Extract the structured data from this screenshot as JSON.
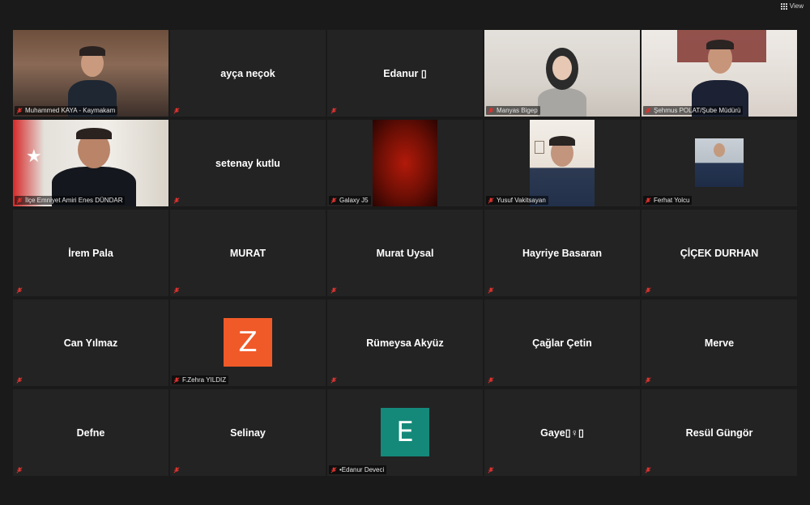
{
  "toolbar": {
    "view_label": "View"
  },
  "colors": {
    "background": "#1a1a1a",
    "tile": "#232323",
    "active_speaker_border": "#d6e86b",
    "muted_icon": "#e0332f"
  },
  "tiles": [
    {
      "type": "video",
      "label": "Muhammed KAYA - Kaymakam",
      "muted": true
    },
    {
      "type": "name",
      "name": "ayça neçok",
      "muted": true
    },
    {
      "type": "name",
      "name": "Edanur ▯",
      "muted": true
    },
    {
      "type": "video",
      "label": "Manyas Bigep",
      "muted": true
    },
    {
      "type": "video",
      "label": "Şehmus POLAT/Şube Müdürü",
      "muted": true
    },
    {
      "type": "video",
      "label": "İlçe Emniyet Amiri Enes DÜNDAR",
      "muted": true,
      "active": true
    },
    {
      "type": "name",
      "name": "setenay kutlu",
      "muted": true
    },
    {
      "type": "video",
      "label": "Galaxy J5",
      "muted": true
    },
    {
      "type": "video",
      "label": "Yusuf Vakitsayan",
      "muted": true
    },
    {
      "type": "video",
      "label": "Ferhat Yolcu",
      "muted": true
    },
    {
      "type": "name",
      "name": "İrem Pala",
      "muted": true
    },
    {
      "type": "name",
      "name": "MURAT",
      "muted": true
    },
    {
      "type": "name",
      "name": "Murat Uysal",
      "muted": true
    },
    {
      "type": "name",
      "name": "Hayriye Basaran",
      "muted": true
    },
    {
      "type": "name",
      "name": "ÇİÇEK DURHAN",
      "muted": true
    },
    {
      "type": "name",
      "name": "Can Yılmaz",
      "muted": true
    },
    {
      "type": "avatar",
      "letter": "Z",
      "color": "#f05a28",
      "label": "F.Zehra YILDIZ",
      "muted": true
    },
    {
      "type": "name",
      "name": "Rümeysa Akyüz",
      "muted": true
    },
    {
      "type": "name",
      "name": "Çağlar Çetin",
      "muted": true
    },
    {
      "type": "name",
      "name": "Merve",
      "muted": true
    },
    {
      "type": "name",
      "name": "Defne",
      "muted": true
    },
    {
      "type": "name",
      "name": "Selinay",
      "muted": true
    },
    {
      "type": "avatar",
      "letter": "E",
      "color": "#14897a",
      "label": "•Edanur Deveci",
      "muted": true
    },
    {
      "type": "name",
      "name": "Gaye▯♀▯",
      "muted": true
    },
    {
      "type": "name",
      "name": "Resül Güngör",
      "muted": true
    }
  ]
}
